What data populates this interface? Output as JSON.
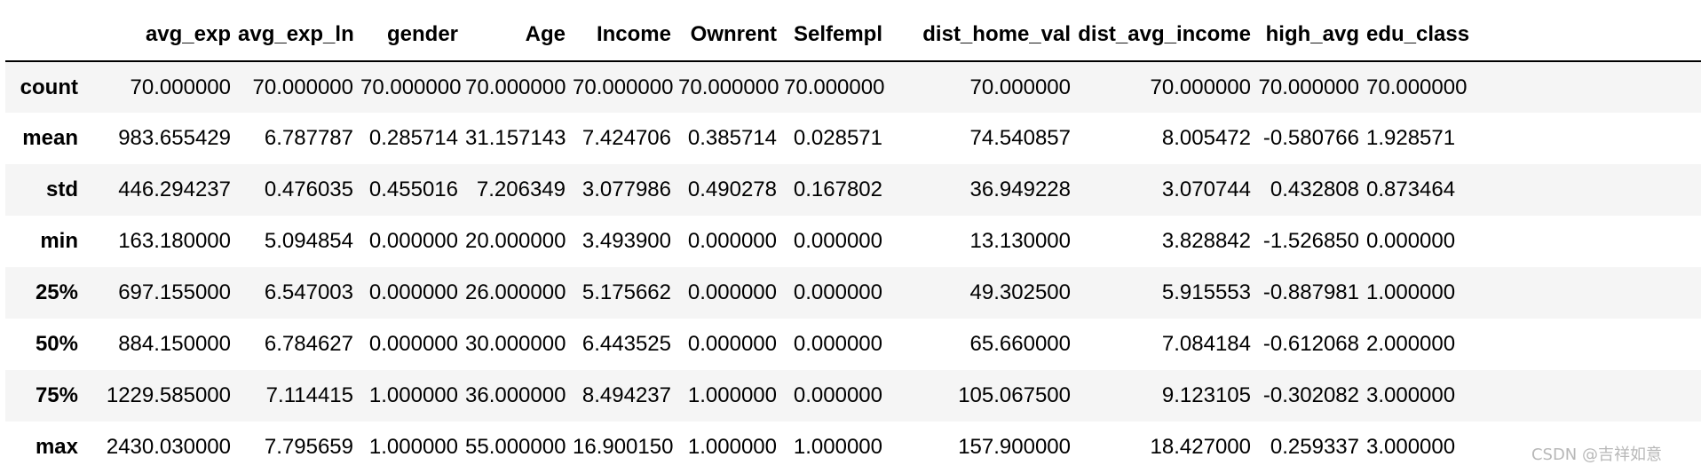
{
  "table": {
    "index_header": "",
    "columns": [
      "avg_exp",
      "avg_exp_ln",
      "gender",
      "Age",
      "Income",
      "Ownrent",
      "Selfempl",
      "dist_home_val",
      "dist_avg_income",
      "high_avg",
      "edu_class"
    ],
    "rows": [
      {
        "label": "count",
        "values": [
          "70.000000",
          "70.000000",
          "70.000000",
          "70.000000",
          "70.000000",
          "70.000000",
          "70.000000",
          "70.000000",
          "70.000000",
          "70.000000",
          "70.000000"
        ]
      },
      {
        "label": "mean",
        "values": [
          "983.655429",
          "6.787787",
          "0.285714",
          "31.157143",
          "7.424706",
          "0.385714",
          "0.028571",
          "74.540857",
          "8.005472",
          "-0.580766",
          "1.928571"
        ]
      },
      {
        "label": "std",
        "values": [
          "446.294237",
          "0.476035",
          "0.455016",
          "7.206349",
          "3.077986",
          "0.490278",
          "0.167802",
          "36.949228",
          "3.070744",
          "0.432808",
          "0.873464"
        ]
      },
      {
        "label": "min",
        "values": [
          "163.180000",
          "5.094854",
          "0.000000",
          "20.000000",
          "3.493900",
          "0.000000",
          "0.000000",
          "13.130000",
          "3.828842",
          "-1.526850",
          "0.000000"
        ]
      },
      {
        "label": "25%",
        "values": [
          "697.155000",
          "6.547003",
          "0.000000",
          "26.000000",
          "5.175662",
          "0.000000",
          "0.000000",
          "49.302500",
          "5.915553",
          "-0.887981",
          "1.000000"
        ]
      },
      {
        "label": "50%",
        "values": [
          "884.150000",
          "6.784627",
          "0.000000",
          "30.000000",
          "6.443525",
          "0.000000",
          "0.000000",
          "65.660000",
          "7.084184",
          "-0.612068",
          "2.000000"
        ]
      },
      {
        "label": "75%",
        "values": [
          "1229.585000",
          "7.114415",
          "1.000000",
          "36.000000",
          "8.494237",
          "1.000000",
          "0.000000",
          "105.067500",
          "9.123105",
          "-0.302082",
          "3.000000"
        ]
      },
      {
        "label": "max",
        "values": [
          "2430.030000",
          "7.795659",
          "1.000000",
          "55.000000",
          "16.900150",
          "1.000000",
          "1.000000",
          "157.900000",
          "18.427000",
          "0.259337",
          "3.000000"
        ]
      }
    ]
  },
  "watermark": "CSDN @吉祥如意"
}
